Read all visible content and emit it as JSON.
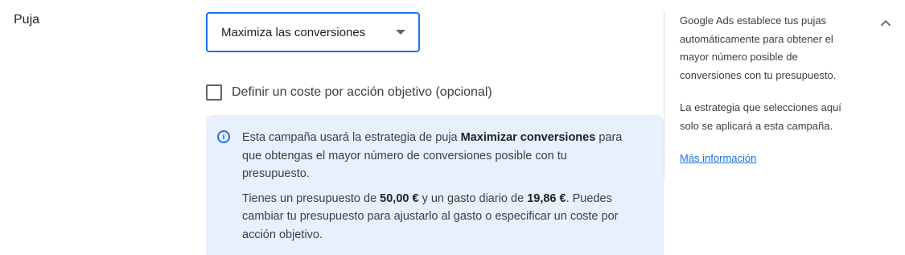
{
  "section": {
    "label": "Puja"
  },
  "strategy_select": {
    "value": "Maximiza las conversiones"
  },
  "target_cpa": {
    "label": "Definir un coste por acción objetivo (opcional)",
    "checked": false
  },
  "info": {
    "p1_before": "Esta campaña usará la estrategia de puja ",
    "p1_bold": "Maximizar conversiones",
    "p1_after": " para que obtengas el mayor número de conversiones posible con tu presupuesto.",
    "p2_before": "Tienes un presupuesto de ",
    "p2_budget": "50,00 €",
    "p2_middle": " y un gasto diario de ",
    "p2_daily": "19,86 €",
    "p2_after": ". Puedes cambiar tu presupuesto para ajustarlo al gasto o especificar un coste por acción objetivo."
  },
  "help": {
    "p1": "Google Ads establece tus pujas automáticamente para obtener el mayor número posible de conversiones con tu presupuesto.",
    "p2": "La estrategia que selecciones aquí solo se aplicará a esta campaña.",
    "link": "Más información"
  },
  "icons": {
    "info": "info-icon",
    "collapse": "chevron-up-icon",
    "dropdown": "caret-down-icon"
  },
  "colors": {
    "accent": "#1a73e8",
    "info_bg": "#e8f0fe"
  }
}
